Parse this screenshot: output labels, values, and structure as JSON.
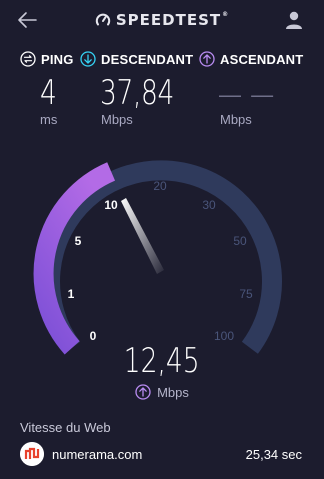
{
  "app": {
    "logo_text": "SPEEDTEST",
    "trademark": "®"
  },
  "metrics": {
    "ping": {
      "label": "PING",
      "value": "4",
      "unit": "ms"
    },
    "download": {
      "label": "DESCENDANT",
      "value": "37,84",
      "unit": "Mbps"
    },
    "upload": {
      "label": "ASCENDANT",
      "value": "— —",
      "unit": "Mbps"
    }
  },
  "gauge": {
    "ticks": [
      "0",
      "1",
      "5",
      "10",
      "20",
      "30",
      "50",
      "75",
      "100"
    ],
    "active_tick": "10",
    "current_value": "12,45",
    "current_unit": "Mbps"
  },
  "web": {
    "section_title": "Vitesse du Web",
    "site_name": "numerama.com",
    "load_time": "25,34 sec"
  },
  "colors": {
    "background": "#1c1c2e",
    "track": "#2f3a5c",
    "progress": "#9b5fe0",
    "download_accent": "#35d2f4",
    "upload_accent": "#b98cf2"
  }
}
